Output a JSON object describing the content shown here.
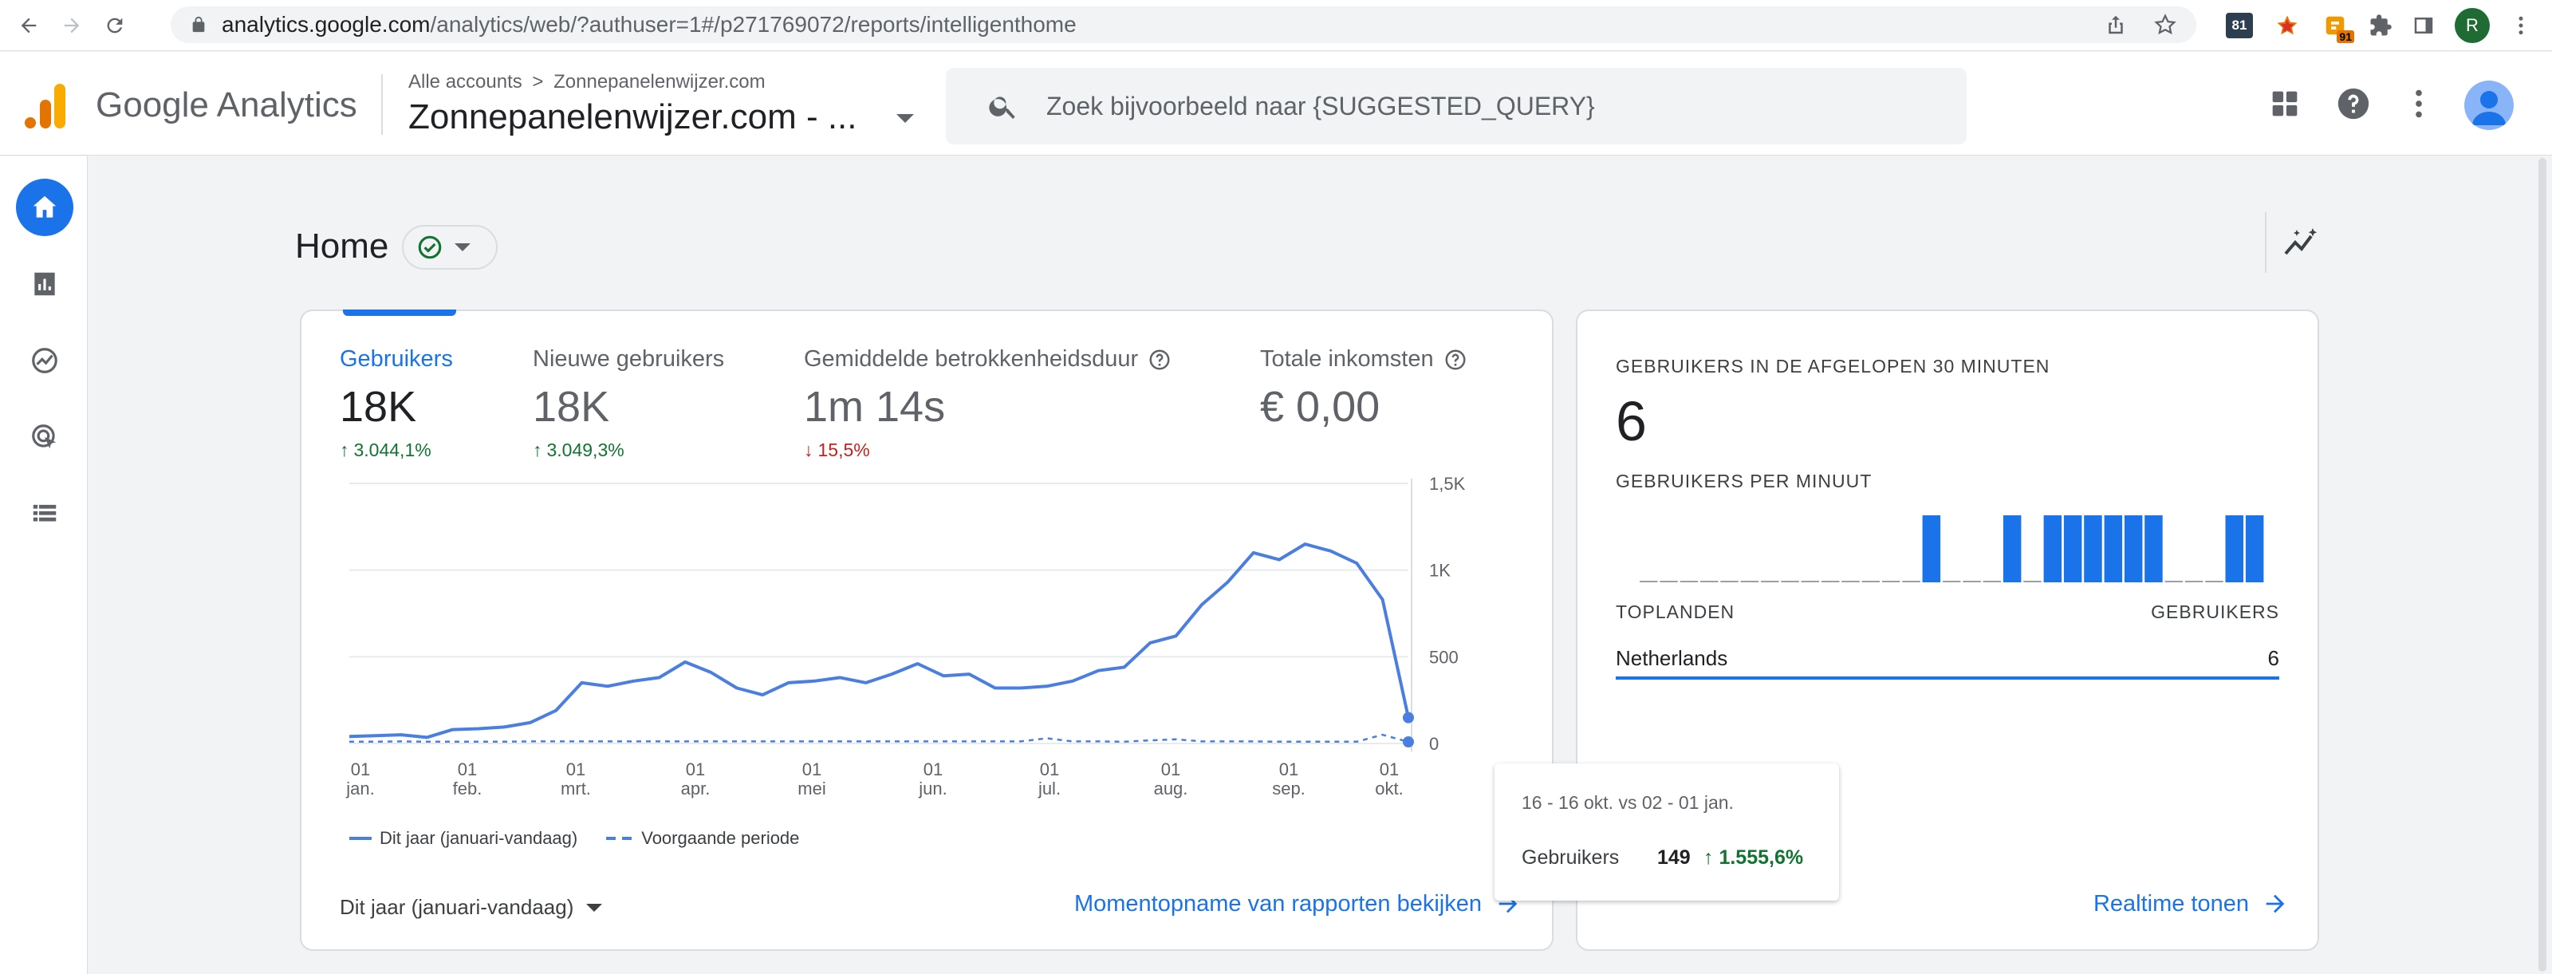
{
  "browser": {
    "url_host": "analytics.google.com",
    "url_path": "/analytics/web/?authuser=1#/p271769072/reports/intelligenthome",
    "ext_badge_1": "81",
    "ext_badge_2": "91",
    "profile_initial": "R"
  },
  "header": {
    "app_name": "Google Analytics",
    "breadcrumb_root": "Alle accounts",
    "breadcrumb_sep": ">",
    "breadcrumb_account": "Zonnepanelenwijzer.com",
    "property_name": "Zonnepanelenwijzer.com - ...",
    "search_placeholder": "Zoek bijvoorbeeld naar {SUGGESTED_QUERY}"
  },
  "page": {
    "title": "Home"
  },
  "metrics": [
    {
      "label": "Gebruikers",
      "value": "18K",
      "delta": "3.044,1%",
      "direction": "up"
    },
    {
      "label": "Nieuwe gebruikers",
      "value": "18K",
      "delta": "3.049,3%",
      "direction": "up"
    },
    {
      "label": "Gemiddelde betrokkenheidsduur",
      "value": "1m 14s",
      "delta": "15,5%",
      "direction": "down"
    },
    {
      "label": "Totale inkomsten",
      "value": "€ 0,00",
      "delta": "",
      "direction": ""
    }
  ],
  "chart_data": {
    "type": "line",
    "x": [
      "01 jan.",
      "01 feb.",
      "01 mrt.",
      "01 apr.",
      "01 mei",
      "01 jun.",
      "01 jul.",
      "01 aug.",
      "01 sep.",
      "01 okt."
    ],
    "ytick_labels": [
      "1,5K",
      "1K",
      "500",
      "0"
    ],
    "ylim": [
      0,
      1500
    ],
    "series": [
      {
        "name": "Dit jaar (januari-vandaag)",
        "style": "solid",
        "values": [
          40,
          45,
          50,
          35,
          80,
          85,
          95,
          120,
          190,
          350,
          330,
          360,
          380,
          470,
          410,
          320,
          280,
          350,
          360,
          380,
          350,
          400,
          460,
          390,
          400,
          320,
          320,
          330,
          360,
          420,
          440,
          580,
          620,
          800,
          930,
          1100,
          1060,
          1150,
          1110,
          1040,
          830,
          149
        ]
      },
      {
        "name": "Voorgaande periode",
        "style": "dashed",
        "values": [
          10,
          10,
          12,
          10,
          10,
          10,
          10,
          12,
          12,
          12,
          12,
          12,
          12,
          12,
          12,
          12,
          12,
          12,
          12,
          12,
          12,
          12,
          12,
          12,
          12,
          12,
          12,
          30,
          12,
          12,
          10,
          18,
          24,
          12,
          12,
          12,
          10,
          10,
          10,
          10,
          50,
          9
        ]
      }
    ],
    "grid": true,
    "color": "#4a7ee0"
  },
  "legend": {
    "series_1": "Dit jaar (januari-vandaag)",
    "series_2": "Voorgaande periode"
  },
  "date_range": "Dit jaar (januari-vandaag)",
  "snapshot_link": "Momentopname van rapporten bekijken",
  "tooltip": {
    "date": "16 - 16 okt. vs 02 - 01 jan.",
    "metric": "Gebruikers",
    "value": "149",
    "delta": "1.555,6%"
  },
  "realtime": {
    "heading": "GEBRUIKERS IN DE AFGELOPEN 30 MINUTEN",
    "value": "6",
    "per_minute_label": "GEBRUIKERS PER MINUUT",
    "per_minute": [
      0,
      0,
      0,
      0,
      0,
      0,
      0,
      0,
      0,
      0,
      0,
      0,
      0,
      0,
      1,
      0,
      0,
      0,
      1,
      0,
      1,
      1,
      1,
      1,
      1,
      1,
      0,
      0,
      0,
      1,
      1
    ],
    "col_country": "TOPLANDEN",
    "col_users": "GEBRUIKERS",
    "rows": [
      {
        "country": "Netherlands",
        "users": "6"
      }
    ],
    "link": "Realtime tonen"
  },
  "colors": {
    "accent": "#1a73e8",
    "up": "#137333",
    "down": "#c5221f"
  }
}
